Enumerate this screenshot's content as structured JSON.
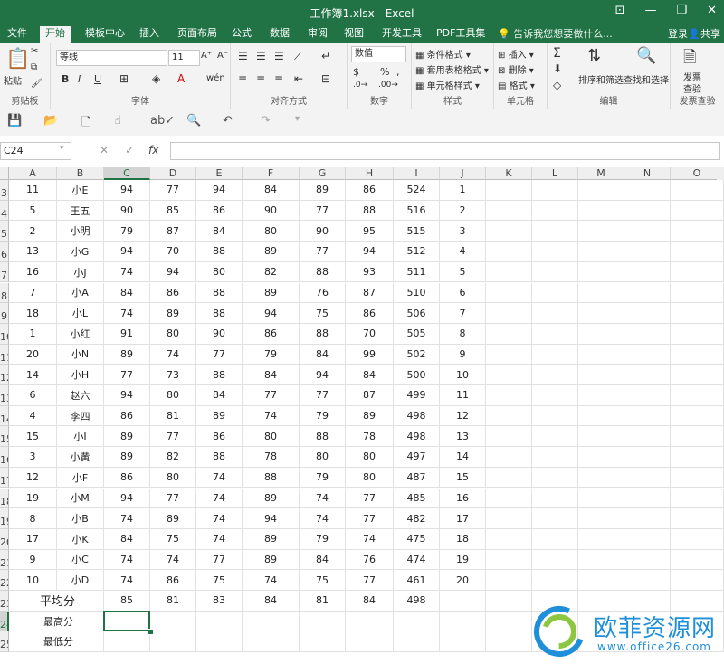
{
  "window": {
    "title": "工作簿1.xlsx - Excel",
    "min": "—",
    "restore": "❐",
    "close": "✕",
    "ribbon_opt": "⊡"
  },
  "tabs": [
    "文件",
    "开始",
    "模板中心",
    "插入",
    "页面布局",
    "公式",
    "数据",
    "审阅",
    "视图",
    "开发工具",
    "PDF工具集"
  ],
  "active_tab": "开始",
  "tell_me": "告诉我您想要做什么...",
  "account": {
    "login": "登录",
    "share": "共享"
  },
  "ribbon": {
    "clipboard": {
      "label": "剪贴板",
      "paste": "粘贴"
    },
    "font": {
      "label": "字体",
      "name": "等线",
      "size": "11",
      "bold": "B",
      "italic": "I",
      "underline": "U",
      "grow": "A⁺",
      "shrink": "A⁻",
      "wen": "wén",
      "fill": "A"
    },
    "align": {
      "label": "对齐方式"
    },
    "number": {
      "label": "数字",
      "format": "数值",
      "percent": "%",
      "comma": ","
    },
    "styles": {
      "label": "样式",
      "cond": "条件格式",
      "table": "套用表格格式",
      "cell": "单元格样式"
    },
    "cells": {
      "label": "单元格",
      "insert": "插入",
      "delete": "删除",
      "format": "格式"
    },
    "edit": {
      "label": "编辑",
      "sort": "排序和筛选",
      "find": "查找和选择"
    },
    "invoice": {
      "label": "发票查验",
      "line1": "发票",
      "line2": "查验"
    }
  },
  "formula_bar": {
    "name_box": "C24",
    "cancel": "✕",
    "enter": "✓",
    "fx": "fx",
    "value": ""
  },
  "columns": [
    "A",
    "B",
    "C",
    "D",
    "E",
    "F",
    "G",
    "H",
    "I",
    "J",
    "K",
    "L",
    "M",
    "N",
    "O"
  ],
  "selected_col": "C",
  "selected_row": "24",
  "rows": [
    {
      "n": "3",
      "cells": [
        "11",
        "小E",
        "94",
        "77",
        "94",
        "84",
        "89",
        "86",
        "524",
        "1"
      ]
    },
    {
      "n": "4",
      "cells": [
        "5",
        "王五",
        "90",
        "85",
        "86",
        "90",
        "77",
        "88",
        "516",
        "2"
      ]
    },
    {
      "n": "5",
      "cells": [
        "2",
        "小明",
        "79",
        "87",
        "84",
        "80",
        "90",
        "95",
        "515",
        "3"
      ]
    },
    {
      "n": "6",
      "cells": [
        "13",
        "小G",
        "94",
        "70",
        "88",
        "89",
        "77",
        "94",
        "512",
        "4"
      ]
    },
    {
      "n": "7",
      "cells": [
        "16",
        "小J",
        "74",
        "94",
        "80",
        "82",
        "88",
        "93",
        "511",
        "5"
      ]
    },
    {
      "n": "8",
      "cells": [
        "7",
        "小A",
        "84",
        "86",
        "88",
        "89",
        "76",
        "87",
        "510",
        "6"
      ]
    },
    {
      "n": "9",
      "cells": [
        "18",
        "小L",
        "74",
        "89",
        "88",
        "94",
        "75",
        "86",
        "506",
        "7"
      ]
    },
    {
      "n": "10",
      "cells": [
        "1",
        "小红",
        "91",
        "80",
        "90",
        "86",
        "88",
        "70",
        "505",
        "8"
      ]
    },
    {
      "n": "11",
      "cells": [
        "20",
        "小N",
        "89",
        "74",
        "77",
        "79",
        "84",
        "99",
        "502",
        "9"
      ]
    },
    {
      "n": "12",
      "cells": [
        "14",
        "小H",
        "77",
        "73",
        "88",
        "84",
        "94",
        "84",
        "500",
        "10"
      ]
    },
    {
      "n": "13",
      "cells": [
        "6",
        "赵六",
        "94",
        "80",
        "84",
        "77",
        "77",
        "87",
        "499",
        "11"
      ]
    },
    {
      "n": "14",
      "cells": [
        "4",
        "李四",
        "86",
        "81",
        "89",
        "74",
        "79",
        "89",
        "498",
        "12"
      ]
    },
    {
      "n": "15",
      "cells": [
        "15",
        "小I",
        "89",
        "77",
        "86",
        "80",
        "88",
        "78",
        "498",
        "13"
      ]
    },
    {
      "n": "16",
      "cells": [
        "3",
        "小黄",
        "89",
        "82",
        "88",
        "78",
        "80",
        "80",
        "497",
        "14"
      ]
    },
    {
      "n": "17",
      "cells": [
        "12",
        "小F",
        "86",
        "80",
        "74",
        "88",
        "79",
        "80",
        "487",
        "15"
      ]
    },
    {
      "n": "18",
      "cells": [
        "19",
        "小M",
        "94",
        "77",
        "74",
        "89",
        "74",
        "77",
        "485",
        "16"
      ]
    },
    {
      "n": "19",
      "cells": [
        "8",
        "小B",
        "74",
        "89",
        "74",
        "94",
        "74",
        "77",
        "482",
        "17"
      ]
    },
    {
      "n": "20",
      "cells": [
        "17",
        "小K",
        "84",
        "75",
        "74",
        "89",
        "79",
        "74",
        "475",
        "18"
      ]
    },
    {
      "n": "21",
      "cells": [
        "9",
        "小C",
        "74",
        "74",
        "77",
        "89",
        "84",
        "76",
        "474",
        "19"
      ]
    },
    {
      "n": "22",
      "cells": [
        "10",
        "小D",
        "74",
        "86",
        "75",
        "74",
        "75",
        "77",
        "461",
        "20"
      ]
    }
  ],
  "avg_row": {
    "n": "23",
    "label": "平均分",
    "values": [
      "85",
      "81",
      "83",
      "84",
      "81",
      "84",
      "498"
    ]
  },
  "max_row": {
    "n": "24",
    "label": "最高分"
  },
  "min_row": {
    "n": "25",
    "label": "最低分"
  },
  "watermark": {
    "text": "欧菲资源网",
    "url": "www.office26.com"
  },
  "colors": {
    "accent": "#217346",
    "watermark": "#1e8fd8"
  }
}
